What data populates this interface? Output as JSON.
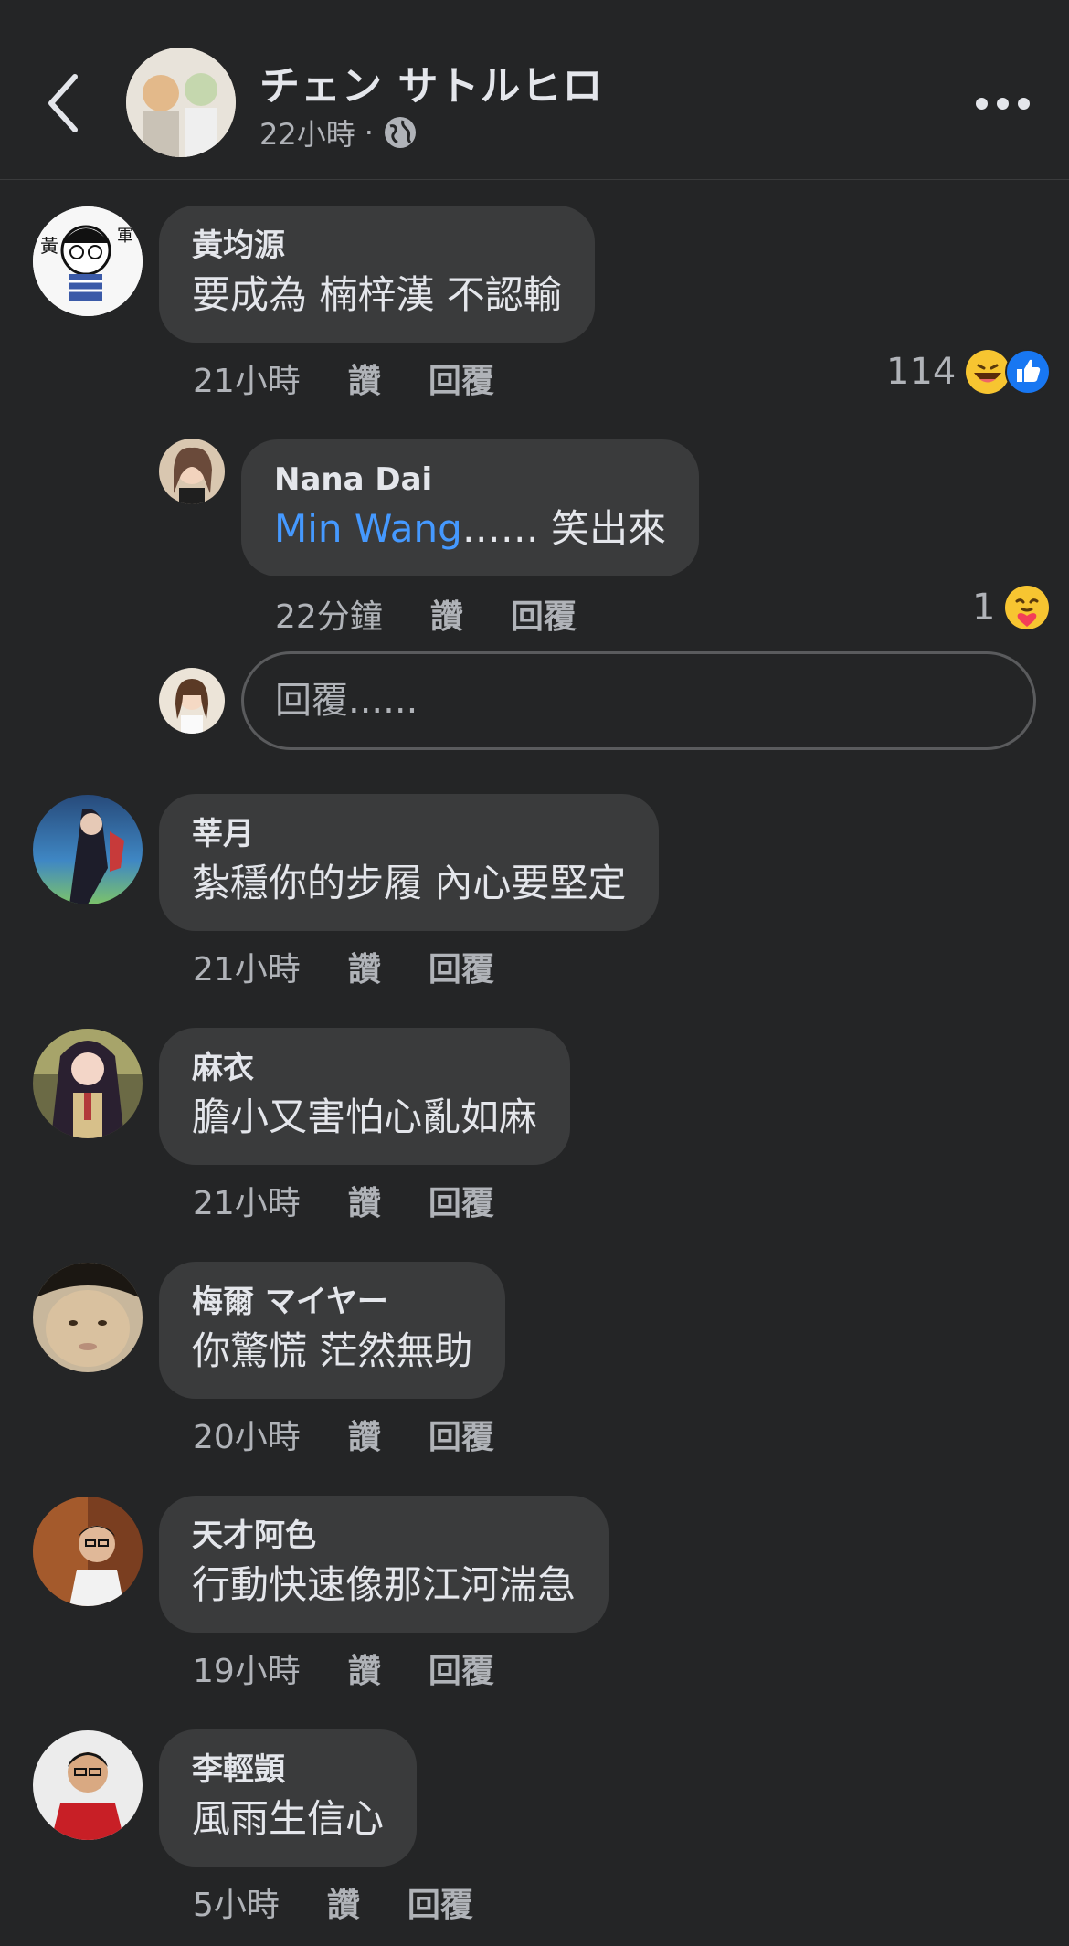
{
  "header": {
    "name": "チェン サトルヒロ",
    "time": "22小時",
    "separator": "·"
  },
  "comments": [
    {
      "author": "黃均源",
      "text": "要成為 楠梓漢 不認輸",
      "time": "21小時",
      "like": "讚",
      "reply": "回覆",
      "reaction_count": "114"
    },
    {
      "author": "Nana Dai",
      "mention": "Min Wang",
      "text": "…… 笑出來",
      "time": "22分鐘",
      "like": "讚",
      "reply": "回覆",
      "reaction_count": "1"
    },
    {
      "author": "莘月",
      "text": "紮穩你的步履 內心要堅定",
      "time": "21小時",
      "like": "讚",
      "reply": "回覆"
    },
    {
      "author": "麻衣",
      "text": "膽小又害怕心亂如麻",
      "time": "21小時",
      "like": "讚",
      "reply": "回覆"
    },
    {
      "author": "梅爾 マイヤー",
      "text": "你驚慌 茫然無助",
      "time": "20小時",
      "like": "讚",
      "reply": "回覆"
    },
    {
      "author": "天才阿色",
      "text": "行動快速像那江河湍急",
      "time": "19小時",
      "like": "讚",
      "reply": "回覆"
    },
    {
      "author": "李輕顗",
      "text": "風雨生信心",
      "time": "5小時",
      "like": "讚",
      "reply": "回覆"
    }
  ],
  "reply_input": {
    "placeholder": "回覆......"
  },
  "icons": [
    "back-arrow-icon",
    "globe-icon",
    "more-icon",
    "laugh-emoji-icon",
    "like-reaction-icon",
    "care-emoji-icon"
  ],
  "colors": {
    "background": "#242526",
    "bubble": "#3a3b3c",
    "mention": "#4599ff",
    "like_blue": "#1877f2"
  }
}
